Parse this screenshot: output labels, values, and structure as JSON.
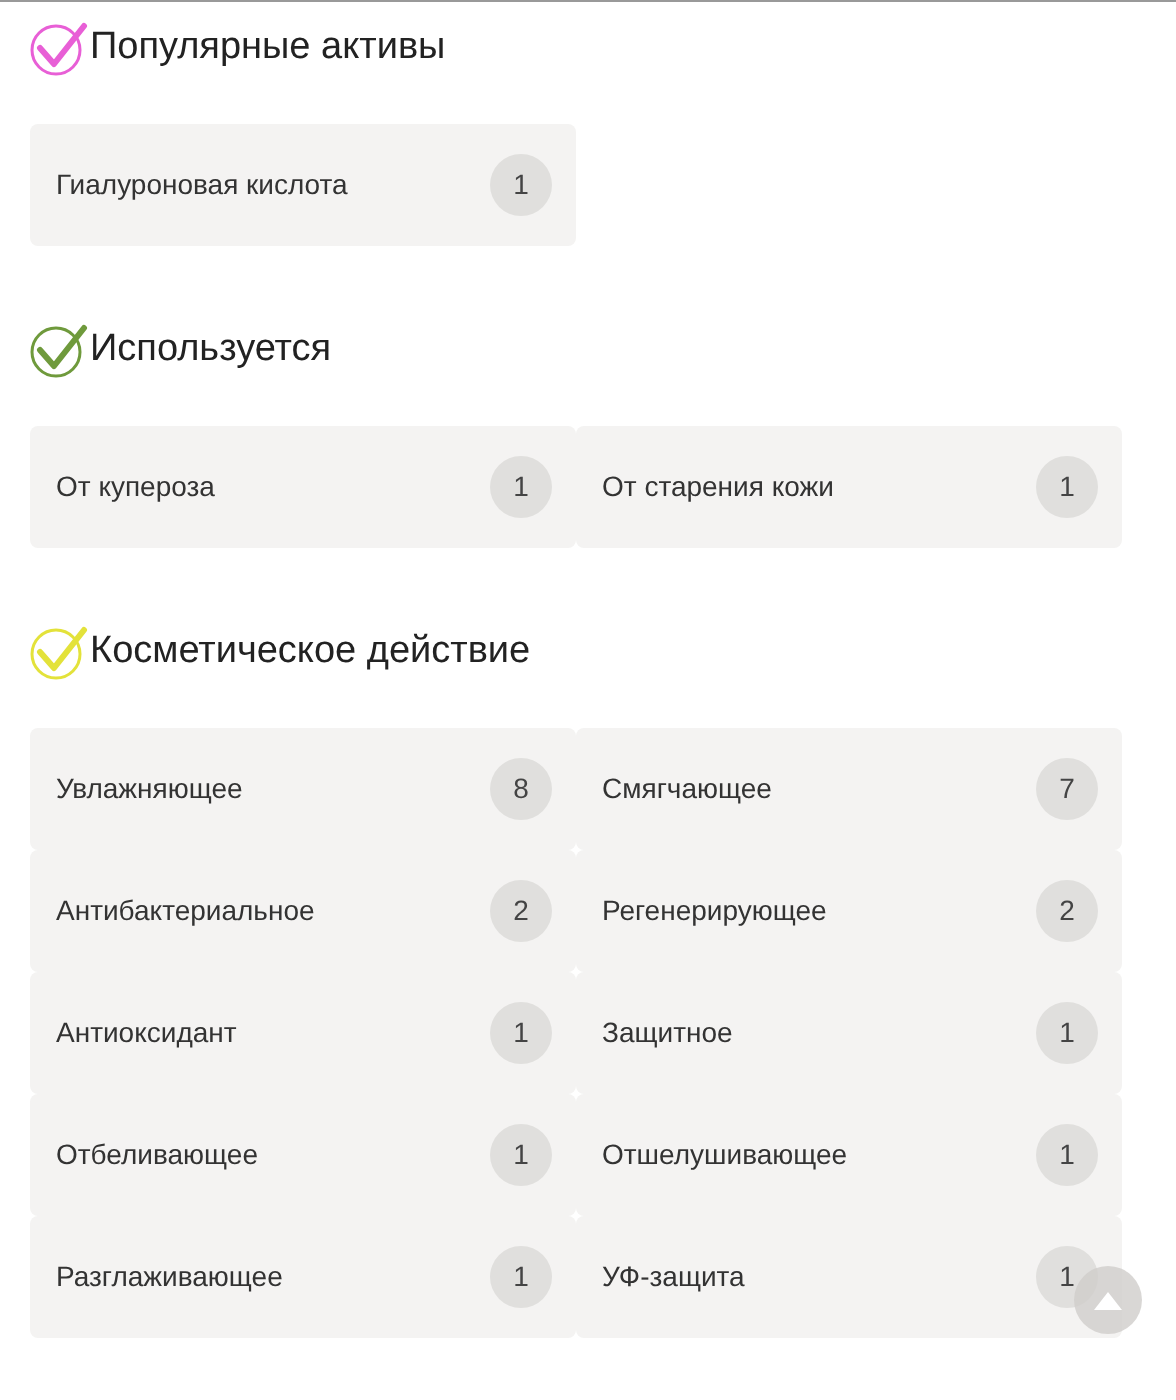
{
  "sections": [
    {
      "title": "Популярные активы",
      "color": "#e85fd6",
      "items": [
        {
          "label": "Гиалуроновая кислота",
          "count": "1"
        }
      ]
    },
    {
      "title": "Используется",
      "color": "#6f9a3c",
      "items": [
        {
          "label": "От купероза",
          "count": "1"
        },
        {
          "label": "От старения кожи",
          "count": "1"
        }
      ]
    },
    {
      "title": "Косметическое действие",
      "color": "#e3e23a",
      "items": [
        {
          "label": "Увлажняющее",
          "count": "8"
        },
        {
          "label": "Смягчающее",
          "count": "7"
        },
        {
          "label": "Антибактериальное",
          "count": "2"
        },
        {
          "label": "Регенерирующее",
          "count": "2"
        },
        {
          "label": "Антиоксидант",
          "count": "1"
        },
        {
          "label": "Защитное",
          "count": "1"
        },
        {
          "label": "Отбеливающее",
          "count": "1"
        },
        {
          "label": "Отшелушивающее",
          "count": "1"
        },
        {
          "label": "Разглаживающее",
          "count": "1"
        },
        {
          "label": "УФ-защита",
          "count": "1"
        }
      ]
    }
  ]
}
